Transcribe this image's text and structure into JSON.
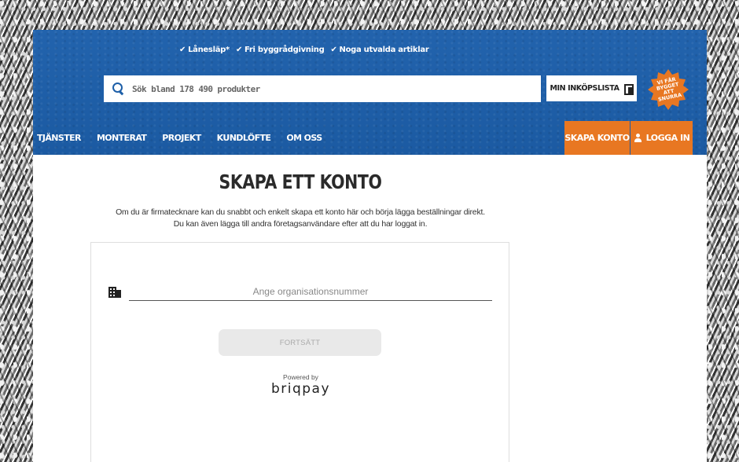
{
  "usps": [
    {
      "icon": "check-icon",
      "label": "Lånesläp*"
    },
    {
      "icon": "check-icon",
      "label": "Fri byggrådgivning"
    },
    {
      "icon": "check-icon",
      "label": "Noga utvalda artiklar"
    }
  ],
  "search": {
    "placeholder": "Sök bland 178 490 produkter"
  },
  "shopping_list": {
    "label": "MIN INKÖPSLISTA"
  },
  "badge": {
    "text": "VI FÅR BYGGET ATT SNURRA"
  },
  "nav": {
    "items": [
      "TJÄNSTER",
      "MONTERAT",
      "PROJEKT",
      "KUNDLÖFTE",
      "OM OSS"
    ],
    "create_account": "SKAPA KONTO",
    "login": "LOGGA IN"
  },
  "main": {
    "title": "SKAPA ETT KONTO",
    "intro_line1": "Om du är firmatecknare kan du snabbt och enkelt skapa ett konto här och börja lägga beställningar direkt.",
    "intro_line2": "Du kan även lägga till andra företagsanvändare efter att du har loggat in."
  },
  "form": {
    "org_placeholder": "Ange organisationsnummer",
    "org_value": "",
    "continue_label": "FORTSÄTT",
    "powered_by": "Powered by",
    "provider": "briqpay"
  },
  "colors": {
    "header_blue": "#1d5fa8",
    "accent_orange": "#e87722"
  }
}
